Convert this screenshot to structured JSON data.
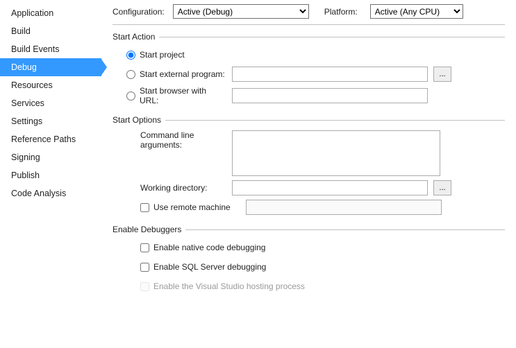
{
  "sidebar": {
    "items": [
      {
        "label": "Application"
      },
      {
        "label": "Build"
      },
      {
        "label": "Build Events"
      },
      {
        "label": "Debug"
      },
      {
        "label": "Resources"
      },
      {
        "label": "Services"
      },
      {
        "label": "Settings"
      },
      {
        "label": "Reference Paths"
      },
      {
        "label": "Signing"
      },
      {
        "label": "Publish"
      },
      {
        "label": "Code Analysis"
      }
    ],
    "selected_index": 3
  },
  "top": {
    "configuration_label": "Configuration:",
    "configuration_value": "Active (Debug)",
    "platform_label": "Platform:",
    "platform_value": "Active (Any CPU)"
  },
  "start_action": {
    "title": "Start Action",
    "start_project": "Start project",
    "start_external": "Start external program:",
    "start_browser": "Start browser with URL:",
    "external_value": "",
    "browser_value": "",
    "browse_label": "..."
  },
  "start_options": {
    "title": "Start Options",
    "cmd_args_label": "Command line arguments:",
    "cmd_args_value": "",
    "working_dir_label": "Working directory:",
    "working_dir_value": "",
    "browse_label": "...",
    "use_remote_label": "Use remote machine",
    "remote_value": ""
  },
  "debuggers": {
    "title": "Enable Debuggers",
    "native_label": "Enable native code debugging",
    "sql_label": "Enable SQL Server debugging",
    "hosting_label": "Enable the Visual Studio hosting process"
  }
}
